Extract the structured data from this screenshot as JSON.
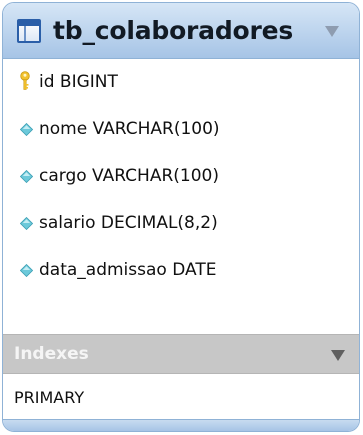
{
  "table": {
    "name": "tb_colaboradores",
    "icon": "table-icon",
    "accent_color": "#a6c4e6"
  },
  "columns": [
    {
      "label": "id BIGINT",
      "icon": "primary-key-icon",
      "icon_color": "#f2c12e"
    },
    {
      "label": "nome VARCHAR(100)",
      "icon": "column-diamond-icon",
      "icon_color": "#6cc9da"
    },
    {
      "label": "cargo VARCHAR(100)",
      "icon": "column-diamond-icon",
      "icon_color": "#6cc9da"
    },
    {
      "label": "salario DECIMAL(8,2)",
      "icon": "column-diamond-icon",
      "icon_color": "#6cc9da"
    },
    {
      "label": "data_admissao DATE",
      "icon": "column-diamond-icon",
      "icon_color": "#6cc9da"
    }
  ],
  "indexes": {
    "label": "Indexes",
    "items": [
      "PRIMARY"
    ]
  }
}
